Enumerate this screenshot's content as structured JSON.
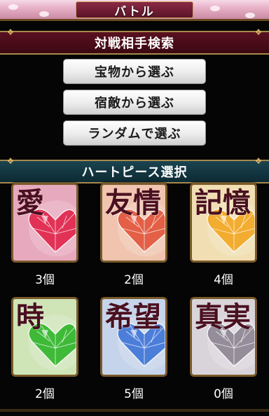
{
  "header": {
    "title": "バトル"
  },
  "search": {
    "heading": "対戦相手検索",
    "buttons": [
      "宝物から選ぶ",
      "宿敵から選ぶ",
      "ランダムで選ぶ"
    ]
  },
  "hearts": {
    "heading": "ハートピース選択",
    "items": [
      {
        "kanji": "愛",
        "count": "3個",
        "bg": "#e7a9bd",
        "gem": "#e0244a"
      },
      {
        "kanji": "友情",
        "count": "2個",
        "bg": "#f0c4ae",
        "gem": "#e2543a"
      },
      {
        "kanji": "記憶",
        "count": "4個",
        "bg": "#f1deb2",
        "gem": "#f2a620"
      },
      {
        "kanji": "時",
        "count": "2個",
        "bg": "#cfe5b7",
        "gem": "#2fb52a"
      },
      {
        "kanji": "希望",
        "count": "5個",
        "bg": "#c5d4ea",
        "gem": "#3d74d6"
      },
      {
        "kanji": "真実",
        "count": "0個",
        "bg": "#d8d4d9",
        "gem": "#8d8693"
      }
    ]
  }
}
